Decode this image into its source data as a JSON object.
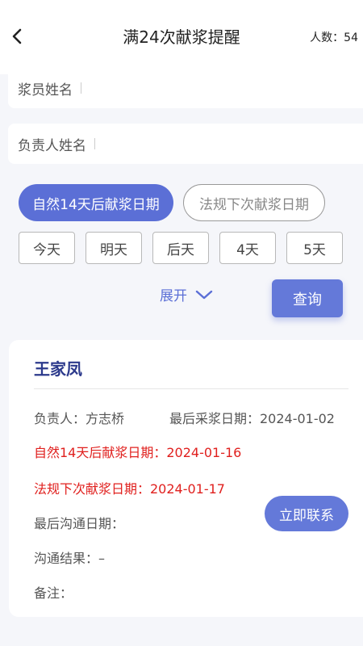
{
  "header": {
    "title": "满24次献浆提醒",
    "count_label": "人数：54"
  },
  "search": {
    "donor_name_label": "浆员姓名",
    "manager_name_label": "负责人姓名"
  },
  "filters": {
    "date_type_options": [
      "自然14天后献浆日期",
      "法规下次献浆日期"
    ],
    "selected_date_type": "自然14天后献浆日期",
    "day_options": [
      "今天",
      "明天",
      "后天",
      "4天",
      "5天"
    ],
    "expand_label": "展开",
    "query_label": "查询"
  },
  "records": [
    {
      "name": "王家凤",
      "manager": "负责人：方志桥",
      "last_collection": "最后采浆日期：2024-01-02",
      "natural_date": "自然14天后献浆日期：2024-01-16",
      "regulatory_date": "法规下次献浆日期：2024-01-17",
      "last_contact": "最后沟通日期：",
      "contact_result": "沟通结果：–",
      "remark": "备注：",
      "contact_button": "立即联系"
    }
  ],
  "colors": {
    "accent": "#5b6fd6",
    "name_text": "#2c3a8c",
    "alert_text": "#e0201e",
    "page_bg": "#f5f6fa"
  },
  "icons": {
    "back": "chevron-left-icon",
    "expand": "chevron-down-icon"
  }
}
